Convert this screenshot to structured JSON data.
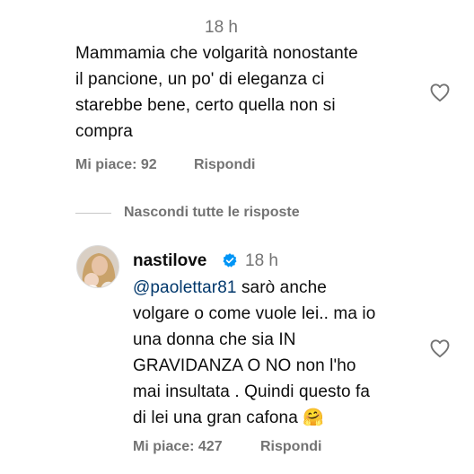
{
  "comment1": {
    "time": "18 h",
    "text_lines": [
      "Mammamia che volgarità nonostante",
      "il pancione, un po' di eleganza ci",
      "starebbe bene, certo quella non si",
      "compra"
    ],
    "likes_label": "Mi piace: 92",
    "reply_label": "Rispondi",
    "like_icon": "heart-outline-icon"
  },
  "replies_toggle": {
    "label": "Nascondi tutte le risposte"
  },
  "reply1": {
    "username": "nastilove",
    "verified_icon": "verified-badge-icon",
    "time": "18 h",
    "mention": "@paolettar81",
    "first_line_rest": " sarò anche",
    "text_lines": [
      "volgare o come vuole lei.. ma io",
      "una donna che sia IN",
      "GRAVIDANZA O NO non l'ho",
      "mai insultata . Quindi questo fa",
      "di lei una gran cafona"
    ],
    "emoji": "🤗",
    "likes_label": "Mi piace: 427",
    "reply_label": "Rispondi",
    "like_icon": "heart-outline-icon",
    "accent_color": "#0095f6",
    "mention_color": "#00376b"
  }
}
